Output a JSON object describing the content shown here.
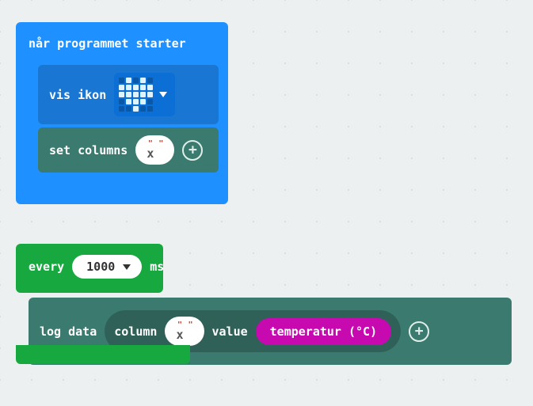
{
  "onstart": {
    "hat_label": "når programmet starter",
    "show_icon_label": "vis ikon",
    "icon_name": "heart",
    "set_columns_label": "set columns",
    "column_value": "x"
  },
  "every": {
    "label_every": "every",
    "interval": "1000",
    "label_ms": "ms",
    "log_data_label": "log data",
    "column_label": "column",
    "column_value": "x",
    "value_label": "value",
    "sensor_label": "temperatur (°C)"
  }
}
